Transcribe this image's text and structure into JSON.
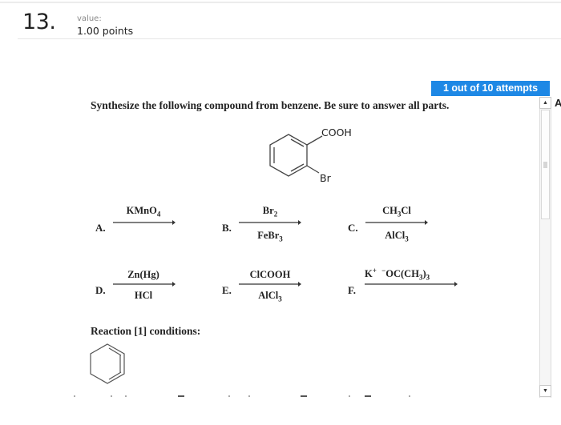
{
  "question": {
    "number": "13.",
    "value_label": "value:",
    "points": "1.00 points"
  },
  "attempts_badge": "1 out of 10 attempts",
  "attempts": {
    "used": 1,
    "total": 10
  },
  "cut_off_letter": "A",
  "colors": {
    "accent": "#1e88e5"
  },
  "prompt": "Synthesize the following compound from benzene. Be sure to answer all parts.",
  "target_molecule": {
    "name": "2-bromobenzoic acid",
    "substituents": {
      "top": "COOH",
      "bottom": "Br"
    }
  },
  "reagents": [
    {
      "letter": "A.",
      "above": [
        "KMnO",
        "4",
        ""
      ],
      "below": null
    },
    {
      "letter": "B.",
      "above": [
        "Br",
        "2",
        ""
      ],
      "below": [
        "FeBr",
        "3",
        ""
      ]
    },
    {
      "letter": "C.",
      "above": [
        "CH",
        "3",
        "Cl"
      ],
      "below": [
        "AlCl",
        "3",
        ""
      ]
    },
    {
      "letter": "D.",
      "above": [
        "Zn(Hg)",
        "",
        ""
      ],
      "below": [
        "HCl",
        "",
        ""
      ]
    },
    {
      "letter": "E.",
      "above": [
        "ClCOOH",
        "",
        ""
      ],
      "below": [
        "AlCl",
        "3",
        ""
      ]
    },
    {
      "letter": "F.",
      "above_parts": {
        "cation": "K",
        "cation_charge": "+",
        "anion_charge": "−",
        "anion": "OC(CH",
        "sub": "3",
        "close": ")",
        "sub2": "3"
      },
      "below": null
    }
  ],
  "conditions": {
    "title": "Reaction [1] conditions:",
    "starting_material": "benzene"
  },
  "scrollbar": {
    "up_icon": "▲",
    "down_icon": "▼"
  }
}
